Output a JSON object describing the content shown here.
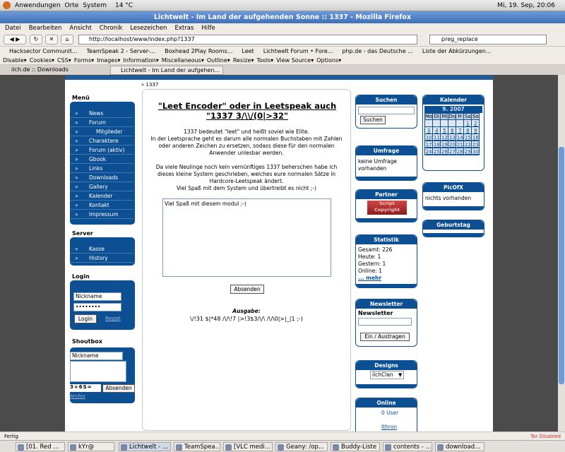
{
  "gnome": {
    "apps": "Anwendungen",
    "places": "Orte",
    "system": "System",
    "temp": "14 °C",
    "clock": "Mi, 19. Sep, 20:06"
  },
  "window": {
    "title": "Lichtwelt - Im Land der aufgehenden Sonne :: 1337 - Mozilla Firefox"
  },
  "menu": [
    "Datei",
    "Bearbeiten",
    "Ansicht",
    "Chronik",
    "Lesezeichen",
    "Extras",
    "Hilfe"
  ],
  "nav": {
    "url": "http://localhost/www/index.php?1337",
    "search": "preg_replace"
  },
  "bookmarks": [
    "Hacksector Communit...",
    "TeamSpeak 2 - Server-...",
    "Boxhead 2Play Rooms...",
    "Leet",
    "Lichtwelt Forum • Fore...",
    "php.de - das Deutsche ...",
    "Liste der Abkürzungen..."
  ],
  "webdev": [
    "Disable▾",
    "Cookies▾",
    "CSS▾",
    "Forms▾",
    "Images▾",
    "Information▾",
    "Miscellaneous▾",
    "Outline▾",
    "Resize▾",
    "Tools▾",
    "View Source▾",
    "Options▾"
  ],
  "tabs": [
    "ilch.de :: Downloads",
    "Lichtwelt - Im Land der aufgehen..."
  ],
  "breadcrumb": "» 1337",
  "left": {
    "menu_title": "Menü",
    "menu": [
      "News",
      "Forum",
      "Mitglieder",
      "Charaktere",
      "Forum (aktiv)",
      "Gbook",
      "Links",
      "Downloads",
      "Gallery",
      "Kalender",
      "Kontakt",
      "Impressum"
    ],
    "server_title": "Server",
    "server": [
      "Kasse",
      "History"
    ],
    "login_title": "Login",
    "login_name": "Nickname",
    "login_pass": "••••••••",
    "login_btn": "Login",
    "register": "Regist",
    "shoutbox_title": "Shoutbox",
    "shout_name": "Nickname",
    "captcha": "3+6S=",
    "shout_btn": "Absenden",
    "archive": "Archiv"
  },
  "center": {
    "heading": "\"Leet Encoder\" oder in Leetspeak auch \"1337 3/\\\\/(0|>32\"",
    "p1": "1337 bedeutet \"leet\" und heißt soviel wie Elite.",
    "p2": "In der Leetsprache geht es darum alle normalen Buchstaben mit Zahlen oder anderen Zeichen zu ersetzen, sodass diese für den normalen Anwender unlesbar werden.",
    "p3": "Da viele Neulinge noch kein vernünftiges 1337 beherschen habe ich dieses kleine System geschrieben, welches eure normalen Sätze in Hardcore-Leetspeak ändert.",
    "p4": "Viel Spaß mit dem System und übertreibt es nicht ;-)",
    "textarea": "Viel Spaß mit diesem modul ;-)",
    "submit": "Absenden",
    "output_label": "Ausgabe:",
    "output": "\\/!31 $|*48 /\\/\\!7 |>!3$3/\\/\\ /\\/\\0|>|_|1 ;-)"
  },
  "right1": {
    "search_title": "Suchen",
    "search_btn": "Suchen",
    "poll_title": "Umfrage",
    "poll_text": "keine Umfrage vorhanden",
    "partner_title": "Partner",
    "partner_banner": "Script Copyright",
    "stats_title": "Statistik",
    "stats": [
      "Gesamt: 226",
      "Heute: 1",
      "Gestern: 1",
      "Online: 1"
    ],
    "stats_more": "... mehr",
    "news_title": "Newsletter",
    "news_label": "Newsletter",
    "news_btn": "Ein / Austragen",
    "designs_title": "Designs",
    "design_value": "ilchClan",
    "online_title": "Online",
    "online_users": "0 User",
    "online_name": "Ithron"
  },
  "right2": {
    "cal_title": "Kalender",
    "cal_month": "9. 2007",
    "cal_days": [
      "Mo",
      "Di",
      "Mi",
      "Do",
      "Fr",
      "Sa",
      "So"
    ],
    "cal_rows": [
      [
        "",
        "",
        "",
        "",
        "",
        "1",
        "2"
      ],
      [
        "3",
        "4",
        "5",
        "6",
        "7",
        "8",
        "9"
      ],
      [
        "10",
        "11",
        "12",
        "13",
        "14",
        "15",
        "16"
      ],
      [
        "17",
        "18",
        "19",
        "20",
        "21",
        "22",
        "23"
      ],
      [
        "24",
        "25",
        "26",
        "27",
        "28",
        "29",
        "30"
      ]
    ],
    "pic_title": "PicOfX",
    "pic_text": "nichts vorhanden",
    "bday_title": "Geburtstag"
  },
  "status": {
    "left": "Fertig",
    "right": "Tor Disabled"
  },
  "taskbar": [
    "[01. Red ...",
    "kYr@",
    "Lichtwelt - ...",
    "TeamSpea...",
    "[VLC medi...",
    "Geany: /op...",
    "Buddy-Liste",
    "contents - ...",
    "download..."
  ]
}
